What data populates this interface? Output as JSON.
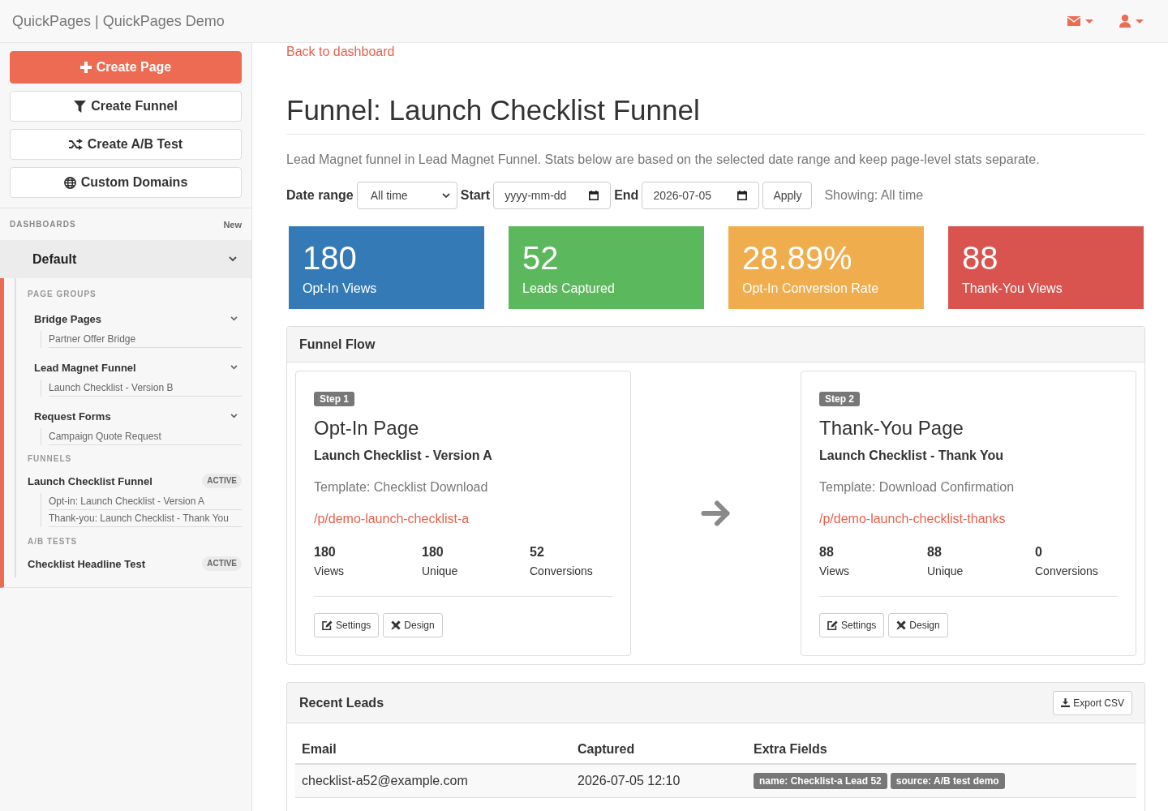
{
  "navbar": {
    "brand": "QuickPages | QuickPages Demo"
  },
  "sidebar": {
    "actions": [
      {
        "label": "Create Page",
        "kind": "primary"
      },
      {
        "label": "Create Funnel",
        "kind": "default"
      },
      {
        "label": "Create A/B Test",
        "kind": "default"
      },
      {
        "label": "Custom Domains",
        "kind": "default"
      }
    ],
    "dashboards_heading": "DASHBOARDS",
    "new_link": "New",
    "dashboards": [
      {
        "label": "Default",
        "selected": true,
        "expanded": true,
        "sections": [
          {
            "heading": "PAGE GROUPS",
            "kind": "groups",
            "items": [
              {
                "label": "Bridge Pages",
                "expanded": true,
                "children": [
                  {
                    "label": "Partner Offer Bridge"
                  }
                ]
              },
              {
                "label": "Lead Magnet Funnel",
                "expanded": true,
                "children": [
                  {
                    "label": "Launch Checklist - Version B"
                  }
                ]
              },
              {
                "label": "Request Forms",
                "expanded": true,
                "children": [
                  {
                    "label": "Campaign Quote Request"
                  }
                ]
              }
            ]
          },
          {
            "heading": "FUNNELS",
            "kind": "funnels",
            "items": [
              {
                "label": "Launch Checklist Funnel",
                "badge": "ACTIVE",
                "children": [
                  {
                    "label": "Opt-in: Launch Checklist - Version A"
                  },
                  {
                    "label": "Thank-you: Launch Checklist - Thank You"
                  }
                ]
              }
            ]
          },
          {
            "heading": "A/B TESTS",
            "kind": "tests",
            "items": [
              {
                "label": "Checklist Headline Test",
                "badge": "ACTIVE"
              }
            ]
          }
        ]
      }
    ]
  },
  "header": {
    "back_link": "Back to dashboard",
    "title": "Funnel: Launch Checklist Funnel",
    "description": "Lead Magnet funnel in Lead Magnet Funnel. Stats below are based on the selected date range and keep page-level stats separate."
  },
  "filters": {
    "range_label": "Date range",
    "range_value": "All time",
    "start_label": "Start",
    "start_placeholder": "yyyy-mm-dd",
    "end_label": "End",
    "end_value": "2026-07-05",
    "apply_button": "Apply",
    "showing": "Showing: All time"
  },
  "stats": [
    {
      "value": "180",
      "label": "Opt-In Views",
      "color": "#337ab7"
    },
    {
      "value": "52",
      "label": "Leads Captured",
      "color": "#5cb85c"
    },
    {
      "value": "28.89%",
      "label": "Opt-In Conversion Rate",
      "color": "#f0ad4e"
    },
    {
      "value": "88",
      "label": "Thank-You Views",
      "color": "#d9534f"
    }
  ],
  "funnel_flow": {
    "title": "Funnel Flow",
    "steps": [
      {
        "badge": "Step 1",
        "title": "Opt-In Page",
        "page": "Launch Checklist - Version A",
        "template": "Template: Checklist Download",
        "url": "/p/demo-launch-checklist-a",
        "metrics": [
          {
            "value": "180",
            "label": "Views"
          },
          {
            "value": "180",
            "label": "Unique"
          },
          {
            "value": "52",
            "label": "Conversions"
          }
        ],
        "buttons": [
          "Settings",
          "Design"
        ]
      },
      {
        "badge": "Step 2",
        "title": "Thank-You Page",
        "page": "Launch Checklist - Thank You",
        "template": "Template: Download Confirmation",
        "url": "/p/demo-launch-checklist-thanks",
        "metrics": [
          {
            "value": "88",
            "label": "Views"
          },
          {
            "value": "88",
            "label": "Unique"
          },
          {
            "value": "0",
            "label": "Conversions"
          }
        ],
        "buttons": [
          "Settings",
          "Design"
        ]
      }
    ]
  },
  "recent_leads": {
    "title": "Recent Leads",
    "export_button": "Export CSV",
    "columns": [
      "Email",
      "Captured",
      "Extra Fields"
    ],
    "rows": [
      {
        "email": "checklist-a52@example.com",
        "captured": "2026-07-05 12:10",
        "extra_fields": [
          "name: Checklist-a Lead 52",
          "source: A/B test demo"
        ]
      }
    ]
  }
}
